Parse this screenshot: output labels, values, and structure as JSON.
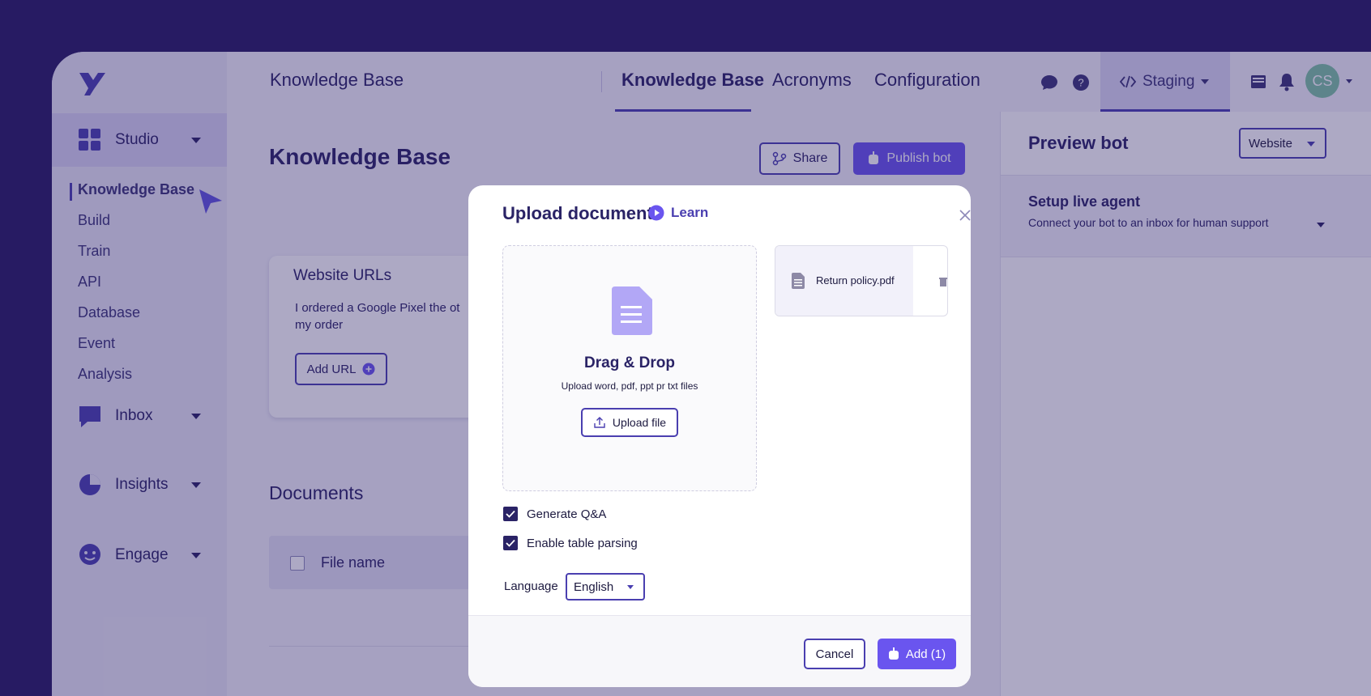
{
  "colors": {
    "accent": "#4a3fb0",
    "primary_button": "#6a55ef",
    "page_bg": "#271a63",
    "avatar": "#7fc3a4"
  },
  "sidebar": {
    "studio_label": "Studio",
    "sub_items": [
      {
        "label": "Knowledge Base"
      },
      {
        "label": "Build"
      },
      {
        "label": "Train"
      },
      {
        "label": "API"
      },
      {
        "label": "Database"
      },
      {
        "label": "Event"
      },
      {
        "label": "Analysis"
      }
    ],
    "groups": [
      {
        "label": "Inbox",
        "icon": "chat-icon"
      },
      {
        "label": "Insights",
        "icon": "pie-chart-icon"
      },
      {
        "label": "Engage",
        "icon": "engage-icon"
      }
    ]
  },
  "topbar": {
    "breadcrumb": "Knowledge Base",
    "tabs": [
      {
        "label": "Knowledge Base"
      },
      {
        "label": "Acronyms"
      },
      {
        "label": "Configuration"
      }
    ],
    "environment": "Staging",
    "avatar_initials": "CS"
  },
  "main": {
    "title": "Knowledge Base",
    "share_label": "Share",
    "publish_label": "Publish bot",
    "website_card": {
      "title": "Website URLs",
      "text_line1": "I ordered a Google Pixel the ot",
      "text_line2": "my order",
      "add_url_label": "Add URL"
    },
    "documents_title": "Documents",
    "table_header_file": "File name"
  },
  "preview": {
    "title": "Preview bot",
    "channel": "Website",
    "live_agent_title": "Setup live agent",
    "live_agent_sub": "Connect your bot to an inbox for human support"
  },
  "modal": {
    "title": "Upload document",
    "learn_label": "Learn",
    "drag_title": "Drag & Drop",
    "drag_sub": "Upload word, pdf, ppt pr txt files",
    "upload_label": "Upload file",
    "file_name": "Return policy.pdf",
    "checkbox_qa": "Generate Q&A",
    "checkbox_table": "Enable table parsing",
    "language_label": "Language",
    "language_value": "English",
    "cancel_label": "Cancel",
    "add_label": "Add (1)"
  }
}
